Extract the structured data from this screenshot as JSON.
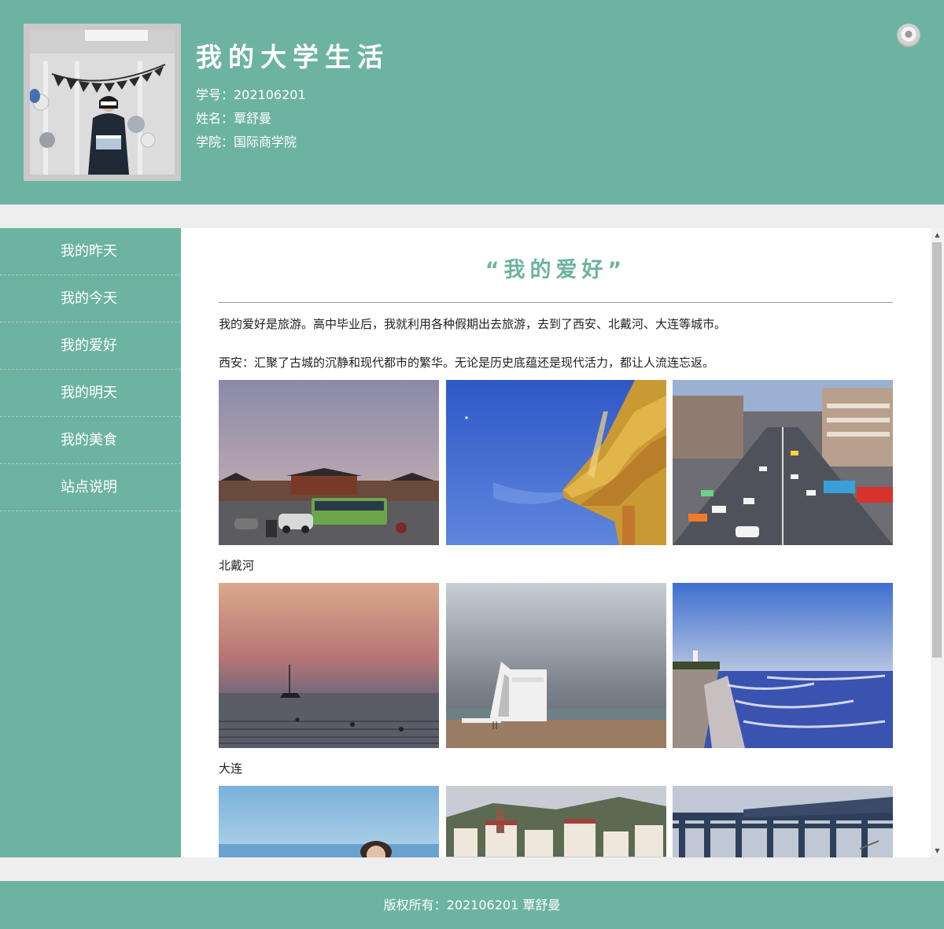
{
  "header": {
    "title": "我的大学生活",
    "student_id": "学号：202106201",
    "name": "姓名：覃舒曼",
    "college": "学院：国际商学院",
    "avatar_banner": "HAPPY BIRTHDAY"
  },
  "sidebar": {
    "items": [
      {
        "label": "我的昨天"
      },
      {
        "label": "我的今天"
      },
      {
        "label": "我的爱好"
      },
      {
        "label": "我的明天"
      },
      {
        "label": "我的美食"
      },
      {
        "label": "站点说明"
      }
    ]
  },
  "main": {
    "title": "“我的爱好”",
    "intro": "我的爱好是旅游。高中毕业后，我就利用各种假期出去旅游，去到了西安、北戴河、大连等城市。",
    "xian": "西安：汇聚了古城的沉静和现代都市的繁华。无论是历史底蕴还是现代活力，都让人流连忘返。",
    "beidaihe_label": "北戴河",
    "dalian_label": "大连"
  },
  "footer": {
    "copyright": "版权所有：202106201 覃舒曼"
  },
  "colors": {
    "accent": "#6db3a1",
    "page_bg": "#eeeeee"
  },
  "icons": {
    "music": "music-disc-icon"
  }
}
